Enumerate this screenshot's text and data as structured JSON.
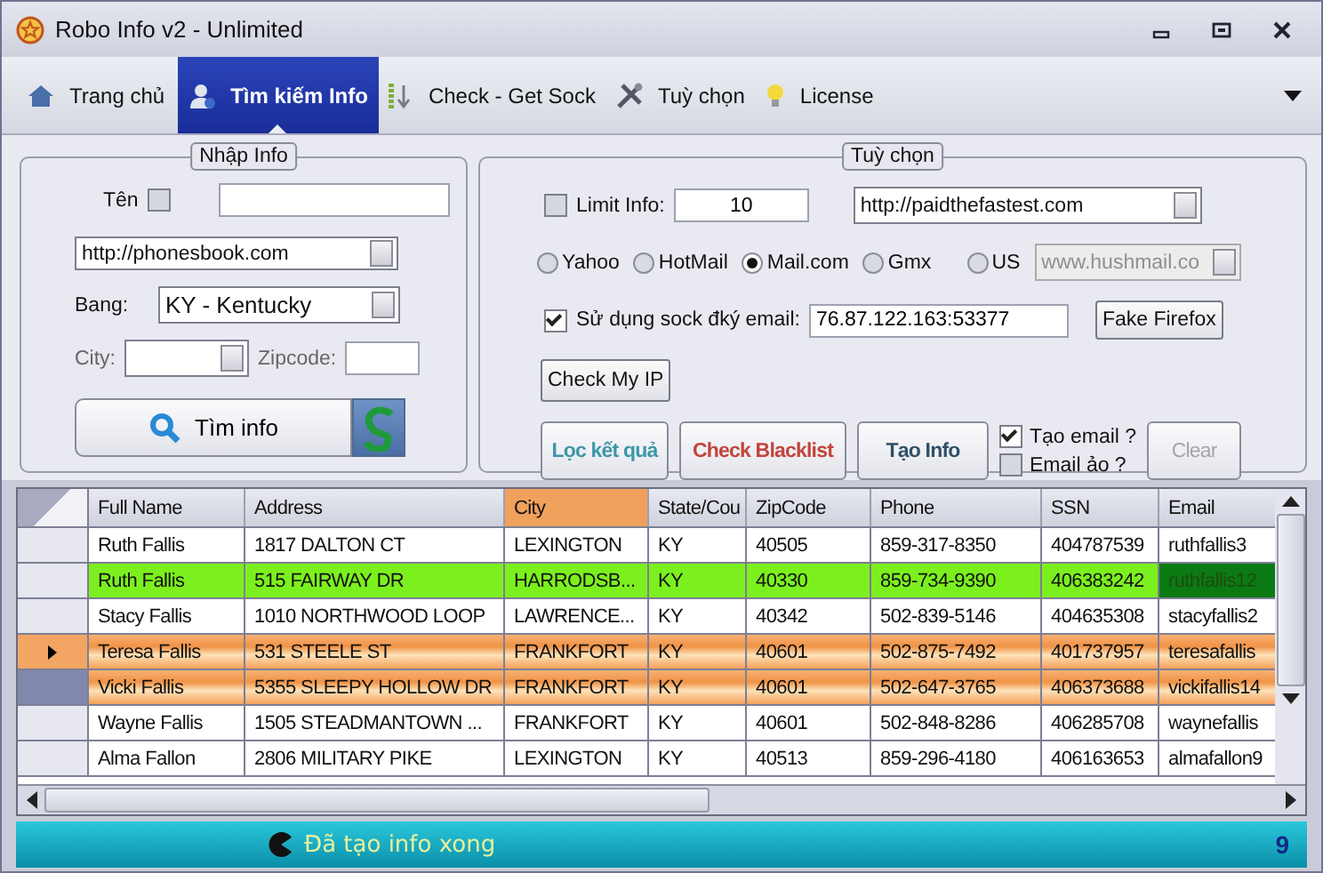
{
  "window": {
    "title": "Robo Info v2 - Unlimited"
  },
  "tabs": [
    {
      "label": "Trang chủ",
      "selected": false
    },
    {
      "label": "Tìm kiếm Info",
      "selected": true
    },
    {
      "label": "Check - Get Sock",
      "selected": false
    },
    {
      "label": "Tuỳ chọn",
      "selected": false
    },
    {
      "label": "License",
      "selected": false
    }
  ],
  "input_panel": {
    "legend": "Nhập Info",
    "name_label": "Tên",
    "name_checked": false,
    "site": "http://phonesbook.com",
    "state_label": "Bang:",
    "state": "KY - Kentucky",
    "city_label": "City:",
    "zip_label": "Zipcode:",
    "search_button": "Tìm info"
  },
  "options_panel": {
    "legend": "Tuỳ chọn",
    "limit_label": "Limit Info:",
    "limit_checked": false,
    "limit": "10",
    "site": "http://paidthefastest.com",
    "providers": [
      {
        "label": "Yahoo",
        "selected": false
      },
      {
        "label": "HotMail",
        "selected": false
      },
      {
        "label": "Mail.com",
        "selected": true
      },
      {
        "label": "Gmx",
        "selected": false
      },
      {
        "label": "US",
        "selected": false
      }
    ],
    "domain": "www.hushmail.co",
    "domain_disabled": true,
    "sock_label": "Sử dụng sock đký email:",
    "sock_checked": true,
    "sock": "76.87.122.163:53377",
    "fake_button": "Fake Firefox",
    "check_ip_button": "Check My IP",
    "actions": [
      {
        "label": "Lọc kết quả",
        "kind": "teal"
      },
      {
        "label": "Check Blacklist",
        "kind": "red"
      },
      {
        "label": "Tạo Info",
        "kind": "dark"
      }
    ],
    "toggles": [
      {
        "label": "Tạo email ?",
        "checked": true
      },
      {
        "label": "Email ảo ?",
        "checked": false
      }
    ],
    "clear_button": "Clear",
    "clear_disabled": true
  },
  "table": {
    "columns": [
      {
        "label": "Full Name",
        "selected": false
      },
      {
        "label": "Address",
        "selected": false
      },
      {
        "label": "City",
        "selected": true
      },
      {
        "label": "State/Cou",
        "selected": false
      },
      {
        "label": "ZipCode",
        "selected": false
      },
      {
        "label": "Phone",
        "selected": false
      },
      {
        "label": "SSN",
        "selected": false
      },
      {
        "label": "Email",
        "selected": false
      }
    ],
    "rows": [
      {
        "kind": "plain",
        "selected": false,
        "focused": false,
        "email_selected": false,
        "cells": [
          "Ruth Fallis",
          "1817 DALTON CT",
          "LEXINGTON",
          "KY",
          "40505",
          "859-317-8350",
          "404787539",
          "ruthfallis3"
        ]
      },
      {
        "kind": "green",
        "selected": false,
        "focused": false,
        "email_selected": true,
        "cells": [
          "Ruth Fallis",
          "515 FAIRWAY DR",
          "HARRODSB...",
          "KY",
          "40330",
          "859-734-9390",
          "406383242",
          "ruthfallis12"
        ]
      },
      {
        "kind": "plain",
        "selected": false,
        "focused": false,
        "email_selected": false,
        "cells": [
          "Stacy Fallis",
          "1010 NORTHWOOD LOOP",
          "LAWRENCE...",
          "KY",
          "40342",
          "502-839-5146",
          "404635308",
          "stacyfallis2"
        ]
      },
      {
        "kind": "orange",
        "selected": true,
        "focused": false,
        "email_selected": false,
        "cells": [
          "Teresa Fallis",
          "531 STEELE ST",
          "FRANKFORT",
          "KY",
          "40601",
          "502-875-7492",
          "401737957",
          "teresafallis"
        ]
      },
      {
        "kind": "orange",
        "selected": false,
        "focused": true,
        "email_selected": false,
        "cells": [
          "Vicki Fallis",
          "5355 SLEEPY HOLLOW DR",
          "FRANKFORT",
          "KY",
          "40601",
          "502-647-3765",
          "406373688",
          "vickifallis14"
        ]
      },
      {
        "kind": "plain",
        "selected": false,
        "focused": false,
        "email_selected": false,
        "cells": [
          "Wayne Fallis",
          "1505 STEADMANTOWN ...",
          "FRANKFORT",
          "KY",
          "40601",
          "502-848-8286",
          "406285708",
          "waynefallis"
        ]
      },
      {
        "kind": "plain",
        "selected": false,
        "focused": false,
        "email_selected": false,
        "cells": [
          "Alma Fallon",
          "2806 MILITARY PIKE",
          "LEXINGTON",
          "KY",
          "40513",
          "859-296-4180",
          "406163653",
          "almafallon9"
        ]
      }
    ]
  },
  "status_bar": {
    "message": "Đã tạo info xong",
    "count": "9"
  }
}
